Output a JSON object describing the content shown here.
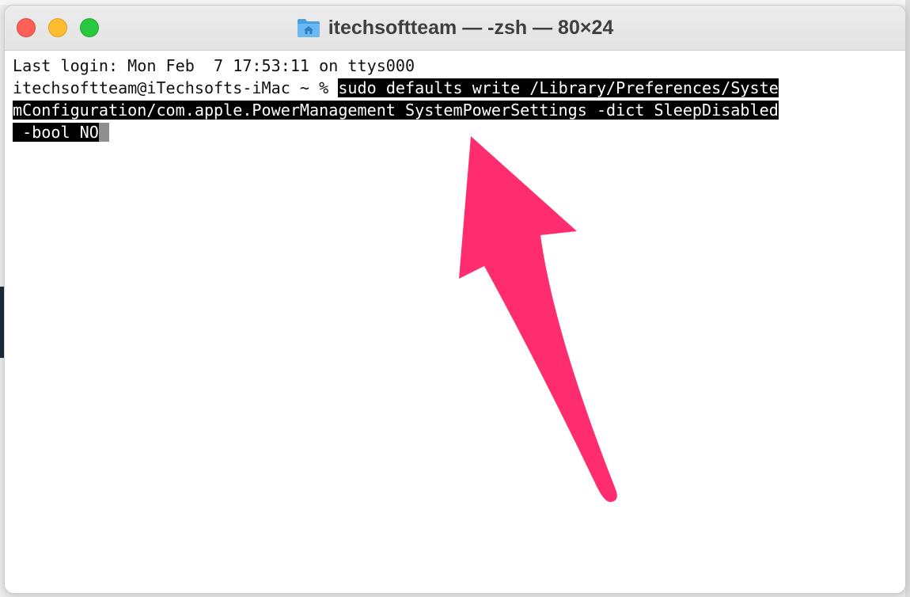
{
  "window": {
    "title": "itechsoftteam — -zsh — 80×24"
  },
  "terminal": {
    "last_login": "Last login: Mon Feb  7 17:53:11 on ttys000",
    "prompt": "itechsoftteam@iTechsofts-iMac ~ % ",
    "command_line1": "sudo defaults write /Library/Preferences/Syste",
    "command_line2": "mConfiguration/com.apple.PowerManagement SystemPowerSettings -dict SleepDisabled",
    "command_line3": " -bool NO"
  },
  "annotation": {
    "arrow_color": "#ff2d6f"
  },
  "icons": {
    "title_icon": "home-folder-icon"
  }
}
